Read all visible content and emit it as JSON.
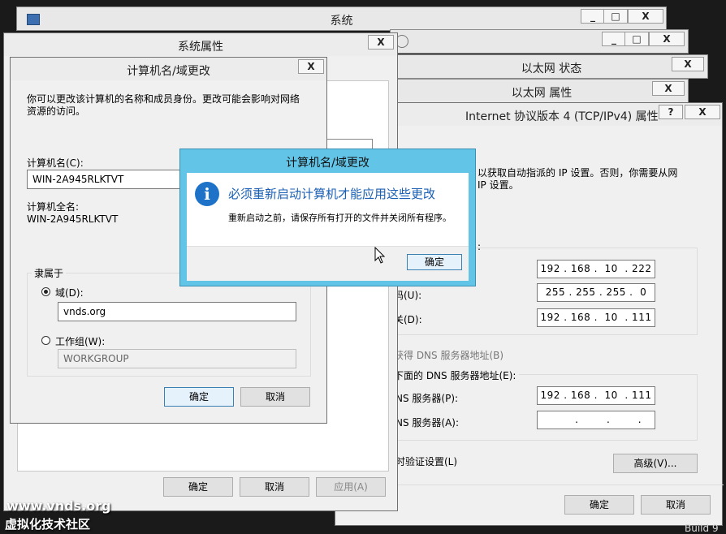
{
  "system_window": {
    "title": "系统",
    "btn_min": "_",
    "btn_max": "□",
    "btn_close": "X"
  },
  "second_window": {
    "btn_min": "_",
    "btn_max": "□",
    "btn_close": "X"
  },
  "system_props": {
    "title": "系统属性",
    "btn_close": "X",
    "ok": "确定",
    "cancel": "取消",
    "apply": "应用(A)"
  },
  "comp_name_dialog": {
    "title": "计算机名/域更改",
    "btn_close": "X",
    "description": "你可以更改该计算机的名称和成员身份。更改可能会影响对网络资源的访问。",
    "computer_name_label": "计算机名(C):",
    "computer_name_value": "WIN-2A945RLKTVT",
    "full_name_label": "计算机全名:",
    "full_name_value": "WIN-2A945RLKTVT",
    "member_of": "隶属于",
    "domain_label": "域(D):",
    "domain_value": "vnds.org",
    "workgroup_label": "工作组(W):",
    "workgroup_value": "WORKGROUP",
    "ok": "确定",
    "cancel": "取消"
  },
  "ethernet_status": {
    "title": "以太网 状态",
    "btn_close": "X"
  },
  "ethernet_props": {
    "title": "以太网 属性",
    "btn_close": "X"
  },
  "ipv4_props": {
    "title": "Internet 协议版本 4 (TCP/IPv4) 属性",
    "btn_help": "?",
    "btn_close": "X",
    "desc_line1": "以获取自动指派的 IP 设置。否则，你需要从网",
    "desc_line2": "IP 设置。",
    "ip_address": "192 . 168 .  10  . 222",
    "subnet_label": "码(U):",
    "subnet_mask": "255 . 255 . 255 .  0",
    "gateway_label": "关(D):",
    "gateway": "192 . 168 .  10  . 111",
    "dns_auto": "获得 DNS 服务器地址(B)",
    "dns_manual": "下面的 DNS 服务器地址(E):",
    "pref_dns_label": "NS 服务器(P):",
    "pref_dns": "192 . 168 .  10  . 111",
    "alt_dns_label": "NS 服务器(A):",
    "alt_dns": "       .        .        .",
    "validate_label": "时验证设置(L)",
    "advanced": "高级(V)...",
    "ok": "确定",
    "cancel": "取消"
  },
  "restart_dialog": {
    "title": "计算机名/域更改",
    "heading": "必须重新启动计算机才能应用这些更改",
    "body": "重新启动之前，请保存所有打开的文件并关闭所有程序。",
    "ok": "确定"
  },
  "watermark": {
    "site": "www.vnds.org",
    "community": "虚拟化技术社区",
    "build": "Build 9"
  },
  "colors": {
    "accent": "#62c5e8",
    "info_blue": "#1e73c8",
    "heading_blue": "#1a5fb4"
  }
}
